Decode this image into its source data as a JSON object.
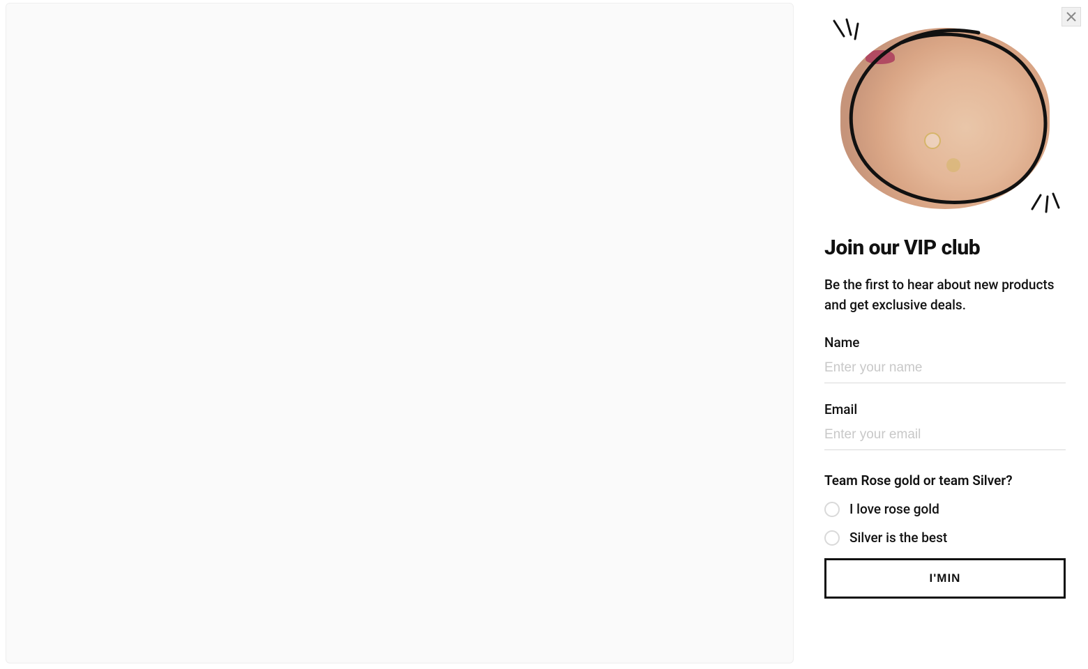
{
  "sidebar": {
    "title": "Join our VIP club",
    "description": "Be the first to hear about new products and get exclusive deals.",
    "fields": {
      "name": {
        "label": "Name",
        "placeholder": "Enter your name",
        "value": ""
      },
      "email": {
        "label": "Email",
        "placeholder": "Enter your email",
        "value": ""
      }
    },
    "question": {
      "label": "Team Rose gold or team Silver?",
      "options": [
        {
          "label": "I love rose gold"
        },
        {
          "label": "Silver is the best"
        }
      ]
    },
    "submit_label": "I'MIN"
  }
}
